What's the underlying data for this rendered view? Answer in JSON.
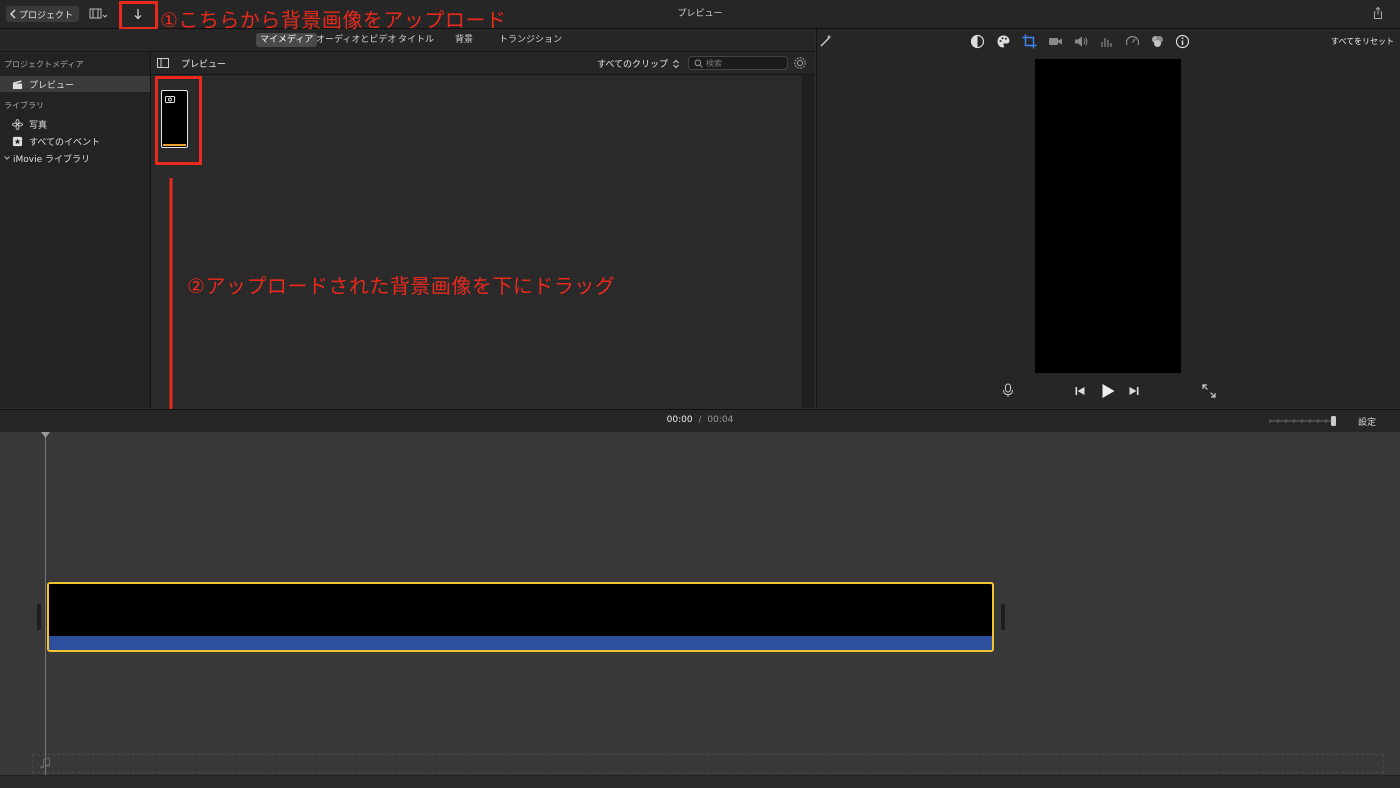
{
  "toolbar": {
    "back_label": "プロジェクト",
    "title": "プレビュー"
  },
  "annotations": {
    "step1": "①こちらから背景画像をアップロード",
    "step2": "②アップロードされた背景画像を下にドラッグ"
  },
  "browser": {
    "tabs": [
      "マイメディア",
      "オーディオとビデオ",
      "タイトル",
      "背景",
      "トランジション"
    ],
    "active_tab": "マイメディア",
    "header_title": "プレビュー",
    "clips_filter": "すべてのクリップ",
    "search_placeholder": "検索"
  },
  "sidebar": {
    "project_media_heading": "プロジェクトメディア",
    "project_item": "プレビュー",
    "library_heading": "ライブラリ",
    "photos": "写真",
    "all_events": "すべてのイベント",
    "imovie_library": "iMovie ライブラリ"
  },
  "viewer": {
    "reset_all": "すべてをリセット"
  },
  "timeline": {
    "current_time": "00:00",
    "separator": "/",
    "total_time": "00:04",
    "settings_label": "設定"
  },
  "colors": {
    "annotation_red": "#e8291c",
    "clip_selection": "#f2c230",
    "clip_audio": "#2e4f9e",
    "accent_blue": "#3a87f5"
  }
}
